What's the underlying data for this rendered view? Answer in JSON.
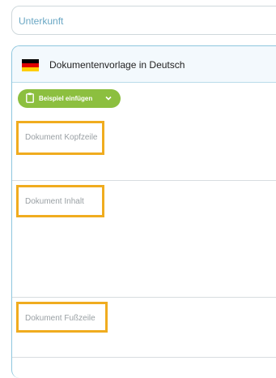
{
  "unterkunft_field": {
    "placeholder": "Unterkunft"
  },
  "template_panel": {
    "title": "Dokumentenvorlage in Deutsch",
    "flag_colors": [
      "#000000",
      "#dd0000",
      "#ffce00"
    ],
    "insert_button": {
      "label": "Beispiel einfügen",
      "color": "#8cbf3f"
    },
    "sections": [
      {
        "placeholder": "Dokument Kopfzeile"
      },
      {
        "placeholder": "Dokument Inhalt"
      },
      {
        "placeholder": "Dokument Fußzeile"
      }
    ],
    "highlight_color": "#f0ac1f"
  }
}
